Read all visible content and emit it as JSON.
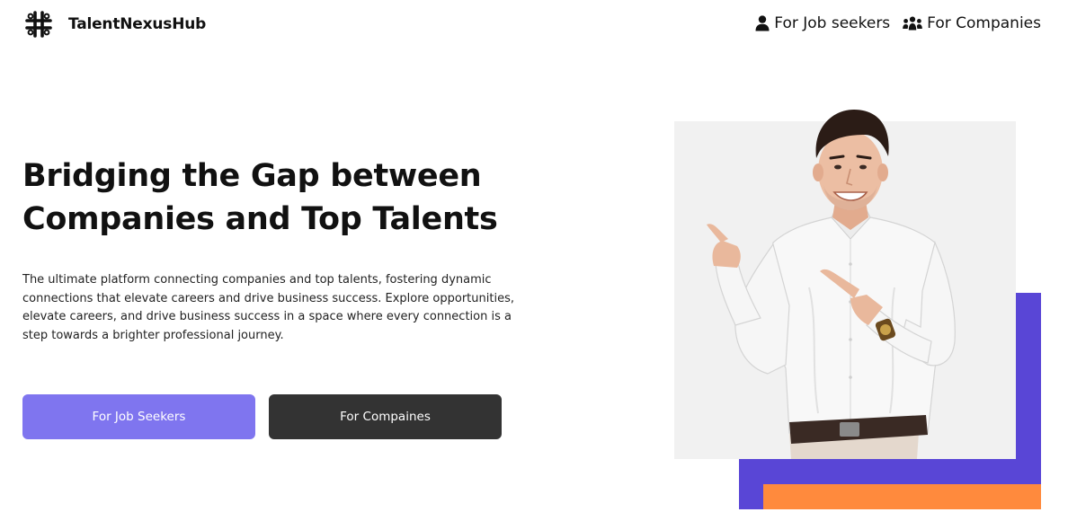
{
  "brand": {
    "name": "TalentNexusHub",
    "logo_icon": "slack-style-hash-logo-icon"
  },
  "nav": {
    "job_seekers": {
      "label": "For Job seekers",
      "icon": "user-icon"
    },
    "companies": {
      "label": "For Companies",
      "icon": "users-group-icon"
    }
  },
  "hero": {
    "title_line1": "Bridging the Gap between",
    "title_line2": "Companies and Top Talents",
    "description": "The ultimate platform connecting companies and top talents, fostering dynamic connections that elevate careers and drive business success. Explore opportunities, elevate careers, and drive business success in a space where every connection is a step towards a brighter professional journey.",
    "buttons": {
      "seekers_label": "For Job Seekers",
      "companies_label": "For Compaines"
    }
  },
  "colors": {
    "primary_button": "#7f75ef",
    "dark_button": "#333333",
    "accent_purple": "#5946d6",
    "accent_orange": "#ff8a3d",
    "photo_background": "#f1f1f1"
  }
}
